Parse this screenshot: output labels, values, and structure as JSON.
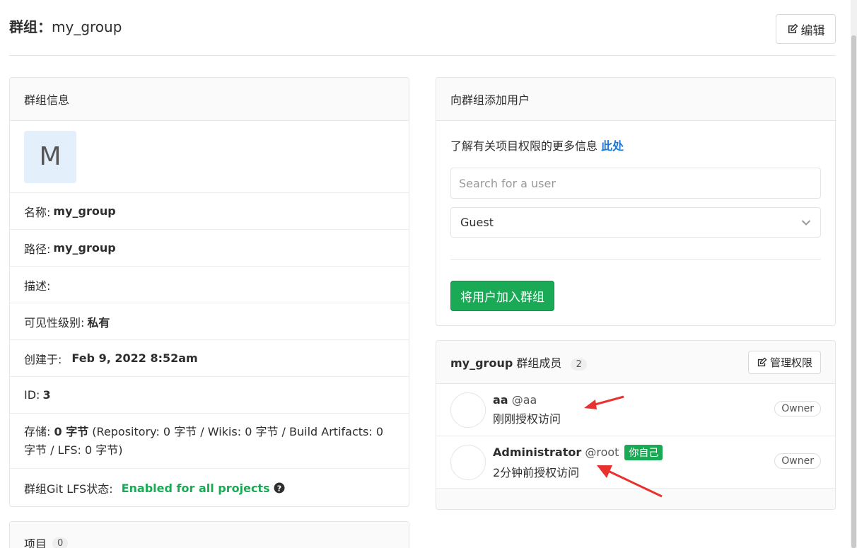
{
  "header": {
    "title_prefix": "群组：",
    "title_name": "my_group",
    "edit_label": "编辑"
  },
  "info": {
    "heading": "群组信息",
    "avatar_letter": "M",
    "name_label": "名称: ",
    "name_value": "my_group",
    "path_label": "路径: ",
    "path_value": "my_group",
    "desc_label": "描述:",
    "visibility_label": "可见性级别: ",
    "visibility_value": "私有",
    "created_label": "创建于: ",
    "created_value": "Feb 9, 2022 8:52am",
    "id_label": "ID: ",
    "id_value": "3",
    "storage_label": "存储: ",
    "storage_value": "0 字节",
    "storage_detail": " (Repository: 0 字节 / Wikis: 0 字节 / Build Artifacts: 0 字节 / LFS: 0 字节)",
    "lfs_label": "群组Git LFS状态: ",
    "lfs_value": "Enabled for all projects"
  },
  "projects": {
    "heading": "项目",
    "count": "0"
  },
  "add_user": {
    "heading": "向群组添加用户",
    "help_text": "了解有关项目权限的更多信息 ",
    "help_link": "此处",
    "search_placeholder": "Search for a user",
    "role_selected": "Guest",
    "submit_label": "将用户加入群组"
  },
  "members": {
    "group_name": "my_group",
    "heading_suffix": " 群组成员",
    "count": "2",
    "manage_label": "管理权限",
    "list": [
      {
        "name": "aa",
        "handle": "@aa",
        "sub": "刚刚授权访问",
        "role": "Owner",
        "you": ""
      },
      {
        "name": "Administrator",
        "handle": "@root",
        "sub": "2分钟前授权访问",
        "role": "Owner",
        "you": "你自己"
      }
    ]
  },
  "colors": {
    "accent_green": "#1aaa55",
    "link_blue": "#1f78d1",
    "annotation_red": "#e8322f"
  }
}
